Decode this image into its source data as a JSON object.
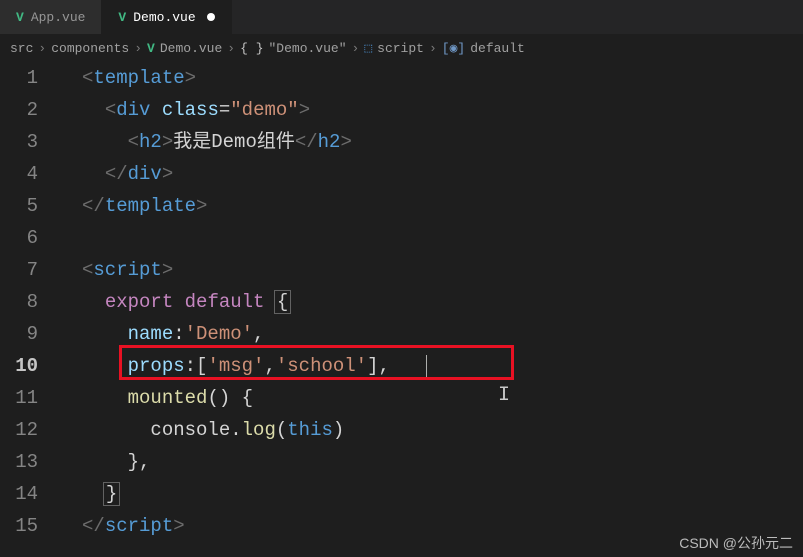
{
  "tabs": [
    {
      "label": "App.vue",
      "icon": "V"
    },
    {
      "label": "Demo.vue",
      "icon": "V"
    }
  ],
  "breadcrumb": {
    "seg0": "src",
    "seg1": "components",
    "seg2": "Demo.vue",
    "seg3": "\"Demo.vue\"",
    "seg4": "script",
    "seg5": "default",
    "sep": "›"
  },
  "gutter": {
    "l1": "1",
    "l2": "2",
    "l3": "3",
    "l4": "4",
    "l5": "5",
    "l6": "6",
    "l7": "7",
    "l8": "8",
    "l9": "9",
    "l10": "10",
    "l11": "11",
    "l12": "12",
    "l13": "13",
    "l14": "14",
    "l15": "15"
  },
  "code": {
    "l1": {
      "open": "<",
      "tag": "template",
      "close": ">"
    },
    "l2": {
      "open": "<",
      "tag": "div",
      "attr": "class",
      "eq": "=",
      "val": "\"demo\"",
      "close": ">"
    },
    "l3": {
      "open": "<",
      "tag1": "h2",
      "close1": ">",
      "text": "我是Demo组件",
      "open2": "</",
      "tag2": "h2",
      "close2": ">"
    },
    "l4": {
      "open": "</",
      "tag": "div",
      "close": ">"
    },
    "l5": {
      "open": "</",
      "tag": "template",
      "close": ">"
    },
    "l7": {
      "open": "<",
      "tag": "script",
      "close": ">"
    },
    "l8": {
      "kw1": "export",
      "kw2": "default",
      "brace": "{"
    },
    "l9": {
      "name": "name",
      "colon": ":",
      "val": "'Demo'",
      "comma": ","
    },
    "l10": {
      "name": "props",
      "colon": ":",
      "open": "[",
      "v1": "'msg'",
      "c": ",",
      "v2": "'school'",
      "close": "]",
      "comma": ","
    },
    "l11": {
      "name": "mounted",
      "paren": "()",
      "brace": "{"
    },
    "l12": {
      "obj": "console",
      "dot": ".",
      "method": "log",
      "open": "(",
      "this": "this",
      "close": ")"
    },
    "l13": {
      "brace": "}",
      "comma": ","
    },
    "l14": {
      "brace": "}"
    },
    "l15": {
      "open": "</",
      "tag": "script",
      "close": ">"
    }
  },
  "watermark": "CSDN @公孙元二"
}
